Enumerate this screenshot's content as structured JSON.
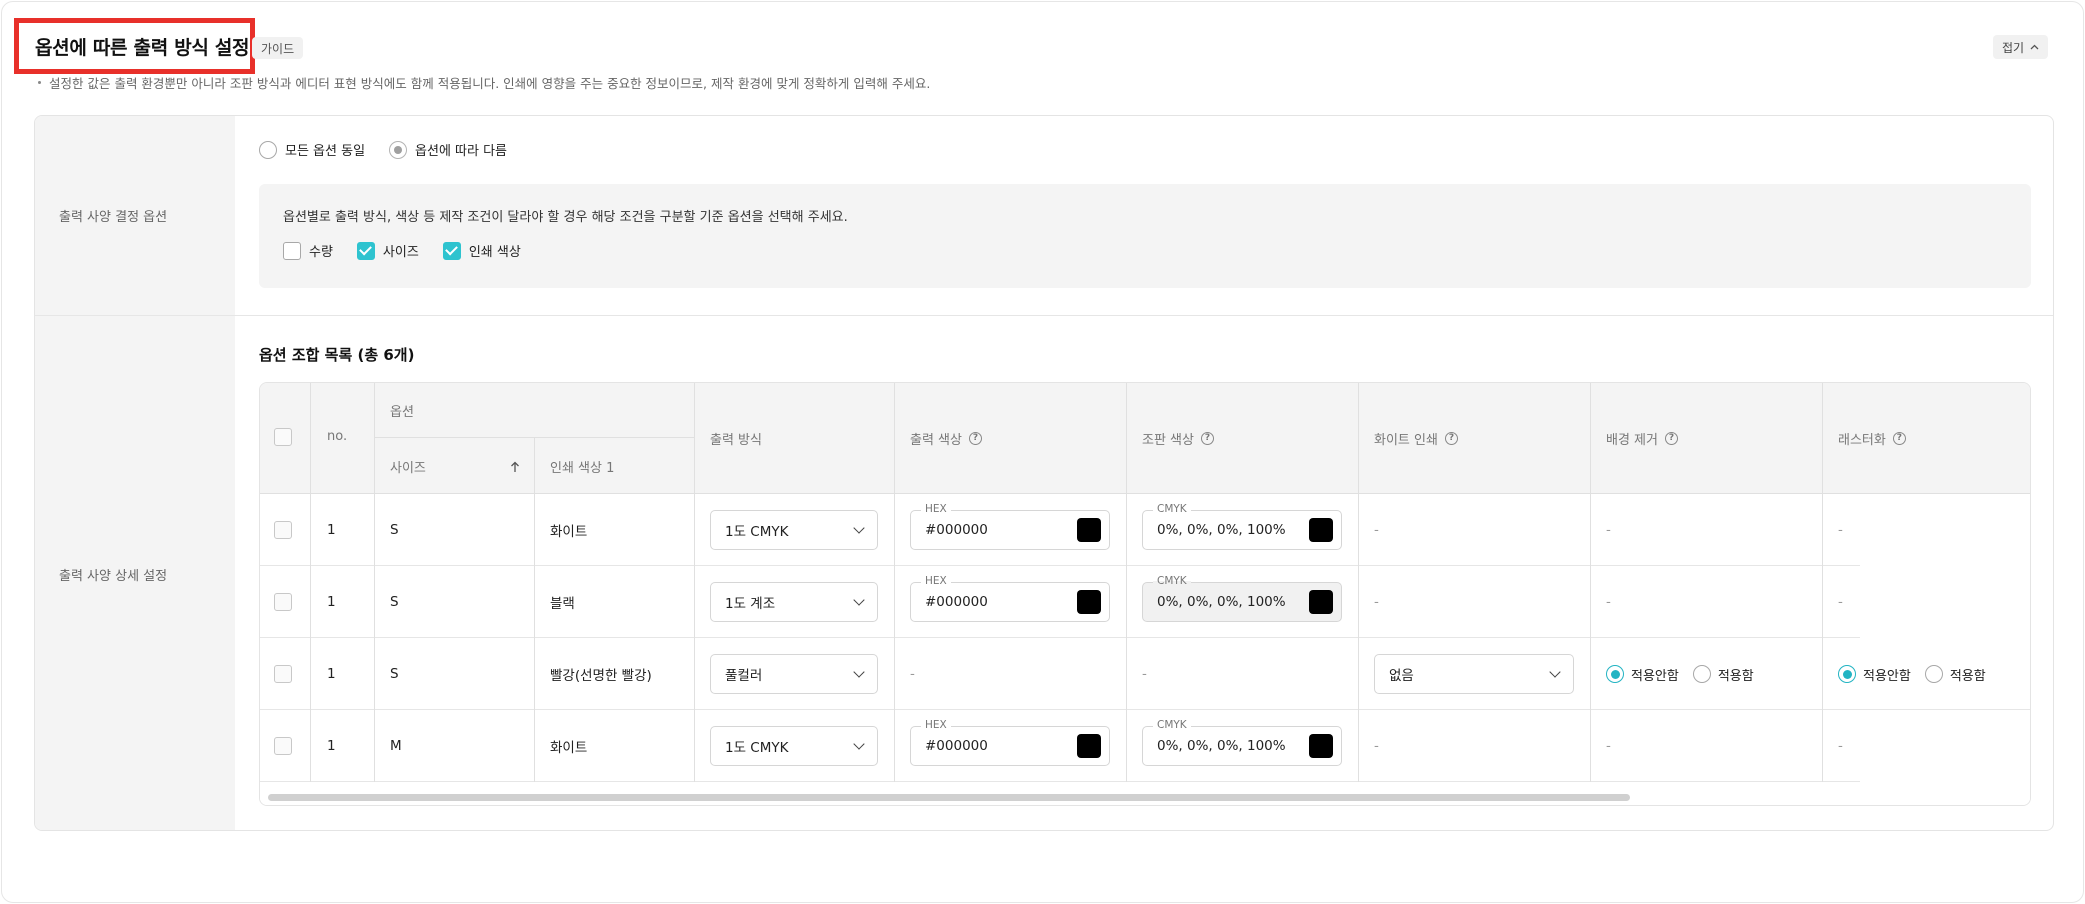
{
  "header": {
    "title": "옵션에 따른 출력 방식 설정",
    "guide_badge": "가이드",
    "collapse_label": "접기",
    "description": "설정한 값은 출력 환경뿐만 아니라 조판 방식과 에디터 표현 방식에도 함께 적용됩니다. 인쇄에 영향을 주는 중요한 정보이므로, 제작 환경에 맞게 정확하게 입력해 주세요."
  },
  "decision": {
    "label": "출력 사양 결정 옵션",
    "radios": [
      {
        "label": "모든 옵션 동일",
        "selected": false
      },
      {
        "label": "옵션에 따라 다름",
        "selected": true
      }
    ],
    "condition_text": "옵션별로 출력 방식, 색상 등 제작 조건이 달라야 할 경우 해당 조건을 구분할 기준 옵션을 선택해 주세요.",
    "checkboxes": [
      {
        "label": "수량",
        "checked": false
      },
      {
        "label": "사이즈",
        "checked": true
      },
      {
        "label": "인쇄 색상",
        "checked": true
      }
    ],
    "accent_color": "#2EC3CF"
  },
  "detail": {
    "label": "출력 사양 상세 설정",
    "list_title": "옵션 조합 목록 (총 6개)",
    "table": {
      "headers": {
        "no": "no.",
        "option_group": "옵션",
        "size": "사이즈",
        "print_color_1": "인쇄 색상 1",
        "output_method": "출력 방식",
        "output_color": "출력 색상",
        "typesetting_color": "조판 색상",
        "white_print": "화이트 인쇄",
        "bg_removal": "배경 제거",
        "rasterize": "래스터화"
      },
      "hex_label": "HEX",
      "cmyk_label": "CMYK",
      "dash": "-",
      "radio_off": "적용안함",
      "radio_on": "적용함",
      "rows": [
        {
          "no": "1",
          "size": "S",
          "color": "화이트",
          "method": "1도 CMYK",
          "hex": "#000000",
          "cmyk": "0%, 0%, 0%, 100%",
          "white_select": "",
          "swatch": "#000000"
        },
        {
          "no": "1",
          "size": "S",
          "color": "블랙",
          "method": "1도 계조",
          "hex": "#000000",
          "cmyk": "0%, 0%, 0%, 100%",
          "white_select": "",
          "swatch": "#000000"
        },
        {
          "no": "1",
          "size": "S",
          "color": "빨강(선명한 빨강)",
          "method": "풀컬러",
          "hex": "",
          "cmyk": "",
          "white_select": "없음",
          "swatch": ""
        },
        {
          "no": "1",
          "size": "M",
          "color": "화이트",
          "method": "1도 CMYK",
          "hex": "#000000",
          "cmyk": "0%, 0%, 0%, 100%",
          "white_select": "",
          "swatch": "#000000"
        }
      ]
    }
  }
}
